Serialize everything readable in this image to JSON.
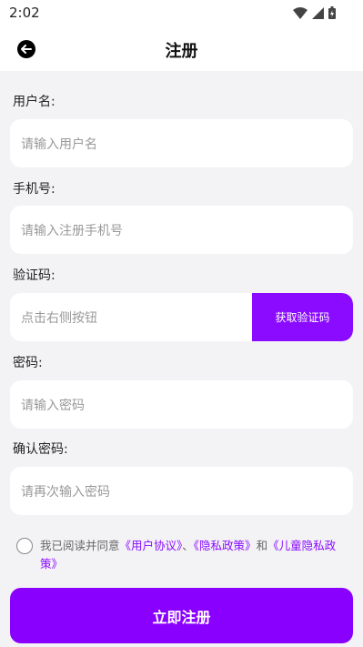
{
  "status_bar": {
    "time": "2:02"
  },
  "header": {
    "title": "注册"
  },
  "form": {
    "username": {
      "label": "用户名:",
      "placeholder": "请输入用户名"
    },
    "phone": {
      "label": "手机号:",
      "placeholder": "请输入注册手机号"
    },
    "code": {
      "label": "验证码:",
      "placeholder": "点击右侧按钮",
      "button": "获取验证码"
    },
    "password": {
      "label": "密码:",
      "placeholder": "请输入密码"
    },
    "confirm": {
      "label": "确认密码:",
      "placeholder": "请再次输入密码"
    }
  },
  "agreement": {
    "prefix": "我已阅读并同意",
    "user_agreement": "《用户协议》",
    "sep": "、",
    "privacy_policy": "《隐私政策》",
    "and": "和",
    "children_policy": "《儿童隐私政策》"
  },
  "submit": {
    "label": "立即注册"
  },
  "colors": {
    "accent": "#8a00ff",
    "background": "#f3f3f6"
  },
  "icons": {
    "back": "back-arrow-icon",
    "wifi": "wifi-icon",
    "signal": "signal-icon",
    "battery": "battery-icon"
  }
}
